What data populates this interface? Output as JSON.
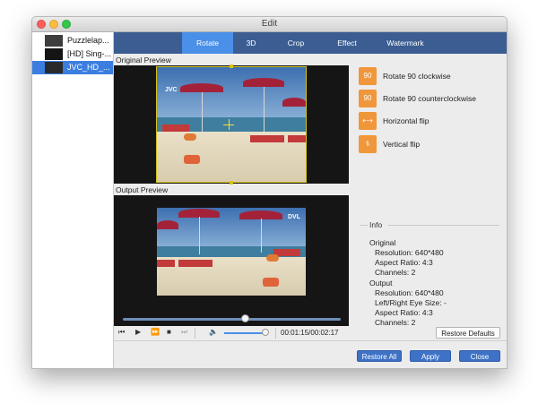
{
  "window": {
    "title": "Edit"
  },
  "files": [
    {
      "name": "Puzzlelap...",
      "selected": false
    },
    {
      "name": "[HD] Sing-...",
      "selected": false
    },
    {
      "name": "JVC_HD_...",
      "selected": true
    }
  ],
  "tabs": [
    {
      "label": "Rotate",
      "active": true
    },
    {
      "label": "3D",
      "active": false
    },
    {
      "label": "Crop",
      "active": false
    },
    {
      "label": "Effect",
      "active": false
    },
    {
      "label": "Watermark",
      "active": false
    }
  ],
  "preview": {
    "original_label": "Original Preview",
    "output_label": "Output Preview",
    "watermark": "JVC",
    "output_watermark": "DVL"
  },
  "rotate_options": [
    {
      "label": "Rotate 90 clockwise",
      "icon": "rotate-cw-icon",
      "glyph": "90"
    },
    {
      "label": "Rotate 90 counterclockwise",
      "icon": "rotate-ccw-icon",
      "glyph": "90"
    },
    {
      "label": "Horizontal flip",
      "icon": "horizontal-flip-icon",
      "glyph": "⟷"
    },
    {
      "label": "Vertical flip",
      "icon": "vertical-flip-icon",
      "glyph": "⥮"
    }
  ],
  "info": {
    "title": "Info",
    "original_heading": "Original",
    "original_resolution": "Resolution: 640*480",
    "original_aspect": "Aspect Ratio: 4:3",
    "original_channels": "Channels: 2",
    "output_heading": "Output",
    "output_resolution": "Resolution: 640*480",
    "output_eye_size": "Left/Right Eye Size: -",
    "output_aspect": "Aspect Ratio: 4:3",
    "output_channels": "Channels: 2"
  },
  "playback": {
    "time": "00:01:15/00:02:17",
    "progress": 0.56,
    "volume": 0.85
  },
  "buttons": {
    "restore_defaults": "Restore Defaults",
    "restore_all": "Restore All",
    "apply": "Apply",
    "close": "Close"
  },
  "colors": {
    "tabbar": "#3b5d92",
    "tab_active": "#4a8fe8",
    "icon_orange": "#f0973b",
    "selection": "#3b7ee0",
    "button_blue": "#3e72c6"
  }
}
